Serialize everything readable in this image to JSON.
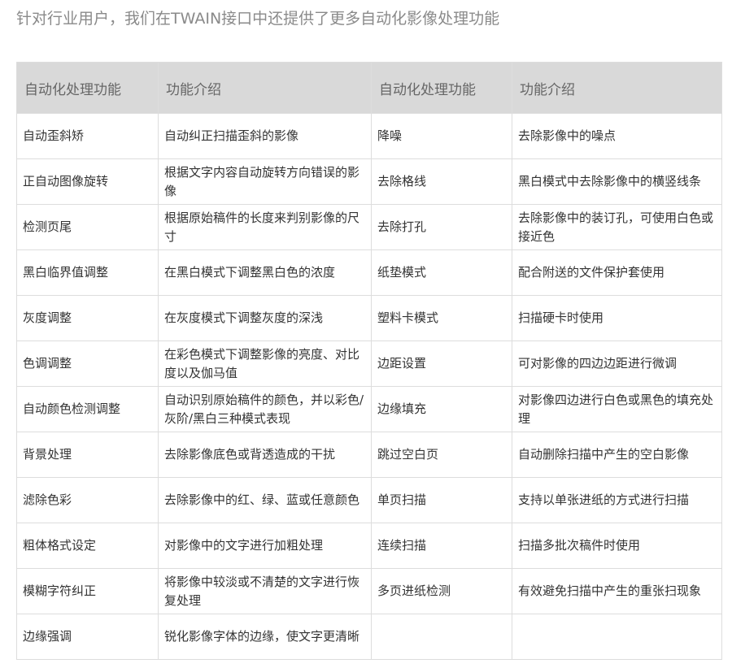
{
  "intro": "针对行业用户，我们在TWAIN接口中还提供了更多自动化影像处理功能",
  "table": {
    "headers": [
      "自动化处理功能",
      "功能介绍",
      "自动化处理功能",
      "功能介绍"
    ],
    "rows": [
      [
        "自动歪斜矫",
        "自动纠正扫描歪斜的影像",
        "降噪",
        "去除影像中的噪点"
      ],
      [
        "正自动图像旋转",
        "根据文字内容自动旋转方向错误的影像",
        "去除格线",
        "黑白模式中去除影像中的横竖线条"
      ],
      [
        "检测页尾",
        "根据原始稿件的长度来判别影像的尺寸",
        "去除打孔",
        "去除影像中的装订孔，可使用白色或接近色"
      ],
      [
        "黑白临界值调整",
        "在黑白模式下调整黑白色的浓度",
        "纸垫模式",
        "配合附送的文件保护套使用"
      ],
      [
        "灰度调整",
        "在灰度模式下调整灰度的深浅",
        "塑料卡模式",
        "扫描硬卡时使用"
      ],
      [
        "色调调整",
        "在彩色模式下调整影像的亮度、对比度以及伽马值",
        "边距设置",
        "可对影像的四边边距进行微调"
      ],
      [
        "自动颜色检测调整",
        "自动识别原始稿件的颜色，并以彩色/灰阶/黑白三种模式表现",
        "边缘填充",
        "对影像四边进行白色或黑色的填充处理"
      ],
      [
        "背景处理",
        "去除影像底色或背透造成的干扰",
        "跳过空白页",
        "自动删除扫描中产生的空白影像"
      ],
      [
        "滤除色彩",
        "去除影像中的红、绿、蓝或任意颜色",
        "单页扫描",
        "支持以单张进纸的方式进行扫描"
      ],
      [
        "粗体格式设定",
        "对影像中的文字进行加粗处理",
        "连续扫描",
        "扫描多批次稿件时使用"
      ],
      [
        "模糊字符纠正",
        "将影像中较淡或不清楚的文字进行恢复处理",
        "多页进纸检测",
        "有效避免扫描中产生的重张扫现象"
      ],
      [
        "边缘强调",
        "锐化影像字体的边缘，使文字更清晰",
        "",
        ""
      ]
    ]
  }
}
